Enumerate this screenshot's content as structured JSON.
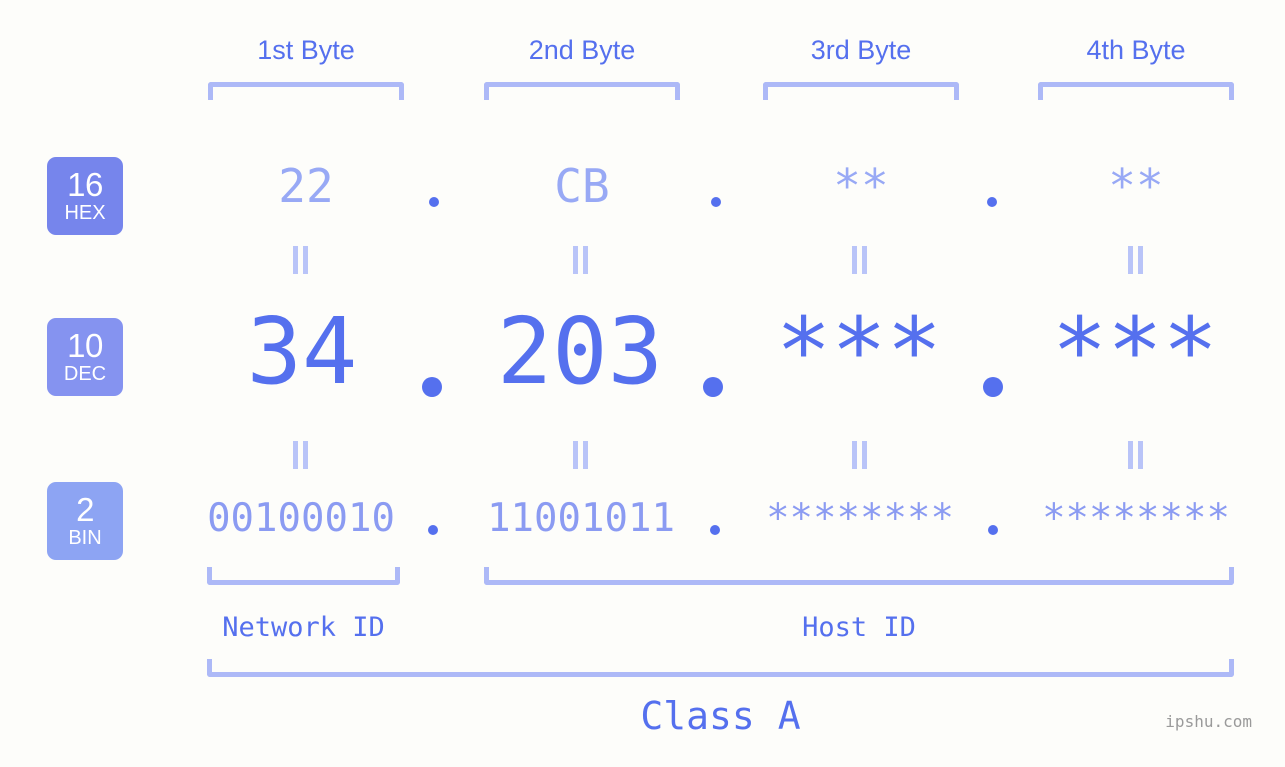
{
  "background_color": "#fdfdfa",
  "accent_color": "#5570ee",
  "accent_light": "#98a9f5",
  "bracket_color": "#adb9f7",
  "byte_headers": [
    {
      "label": "1st Byte"
    },
    {
      "label": "2nd Byte"
    },
    {
      "label": "3rd Byte"
    },
    {
      "label": "4th Byte"
    }
  ],
  "bases": [
    {
      "number": "16",
      "name": "HEX",
      "color": "#7685ec"
    },
    {
      "number": "10",
      "name": "DEC",
      "color": "#8593f0"
    },
    {
      "number": "2",
      "name": "BIN",
      "color": "#8da4f3"
    }
  ],
  "rows": {
    "hex": {
      "base_number": "16",
      "base_name": "HEX",
      "values": [
        "22",
        "CB",
        "**",
        "**"
      ],
      "separator": "."
    },
    "dec": {
      "base_number": "10",
      "base_name": "DEC",
      "values": [
        "34",
        "203",
        "***",
        "***"
      ],
      "separator": "."
    },
    "bin": {
      "base_number": "2",
      "base_name": "BIN",
      "values": [
        "00100010",
        "11001011",
        "********",
        "********"
      ],
      "separator": "."
    }
  },
  "equals_symbol": "=",
  "id_sections": [
    {
      "label": "Network ID"
    },
    {
      "label": "Host ID"
    }
  ],
  "class_label": "Class A",
  "watermark": "ipshu.com"
}
